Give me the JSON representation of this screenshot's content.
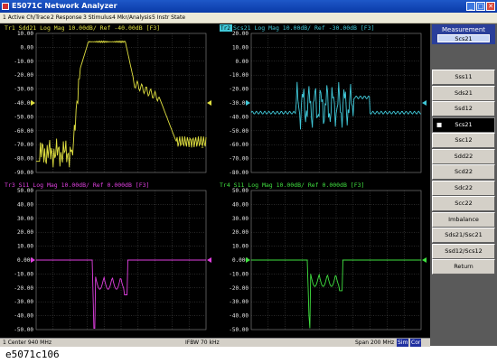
{
  "window": {
    "title": "E5071C Network Analyzer"
  },
  "menu": [
    "1 Active Ch/Trace",
    "2 Response",
    "3 Stimulus",
    "4 Mkr/Analysis",
    "5 Instr State"
  ],
  "traces": [
    {
      "id": "tr1",
      "label": "Tr1 Sdd21 Log Mag 10.00dB/ Ref -40.00dB [F3]",
      "color": "#e0e040",
      "ylabels": [
        "10.00",
        "0.00",
        "-10.00",
        "-20.00",
        "-30.00",
        "-40.00",
        "-50.00",
        "-60.00",
        "-70.00",
        "-80.00",
        "-90.00"
      ]
    },
    {
      "id": "tr2",
      "label": "Scs21 Log Mag 10.00dB/ Ref -30.00dB [F3]",
      "badge": "Tr2",
      "color": "#40c8d8",
      "ylabels": [
        "20.00",
        "10.00",
        "0.00",
        "-10.00",
        "-20.00",
        "-30.00",
        "-40.00",
        "-50.00",
        "-60.00",
        "-70.00",
        "-80.00"
      ]
    },
    {
      "id": "tr3",
      "label": "Tr3 S11 Log Mag 10.00dB/ Ref 0.000dB [F3]",
      "color": "#e040e0",
      "ylabels": [
        "50.00",
        "40.00",
        "30.00",
        "20.00",
        "10.00",
        "0.000",
        "-10.00",
        "-20.00",
        "-30.00",
        "-40.00",
        "-50.00"
      ]
    },
    {
      "id": "tr4",
      "label": "Tr4 S11 Log Mag 10.00dB/ Ref 0.000dB [F3]",
      "color": "#40e040",
      "ylabels": [
        "50.00",
        "40.00",
        "30.00",
        "20.00",
        "10.00",
        "0.000",
        "-10.00",
        "-20.00",
        "-30.00",
        "-40.00",
        "-50.00"
      ]
    }
  ],
  "marker_label": "1",
  "softkeys": {
    "header": "Measurement",
    "current": "Scs21",
    "buttons": [
      "Sss11",
      "Sds21",
      "Ssd12",
      "Scs21",
      "Ssc12",
      "Sdd22",
      "Scd22",
      "Sdc22",
      "Scc22",
      "Imbalance",
      "Sds21/Ssc21",
      "Ssd12/Scs12",
      "Return"
    ],
    "active_index": 3
  },
  "status": {
    "left": "1  Center 940 MHz",
    "mid": "IFBW 70 kHz",
    "span": "Span 200 MHz",
    "tag1": "Sim",
    "tag2": "Cor"
  },
  "caption": "e5071c106"
}
